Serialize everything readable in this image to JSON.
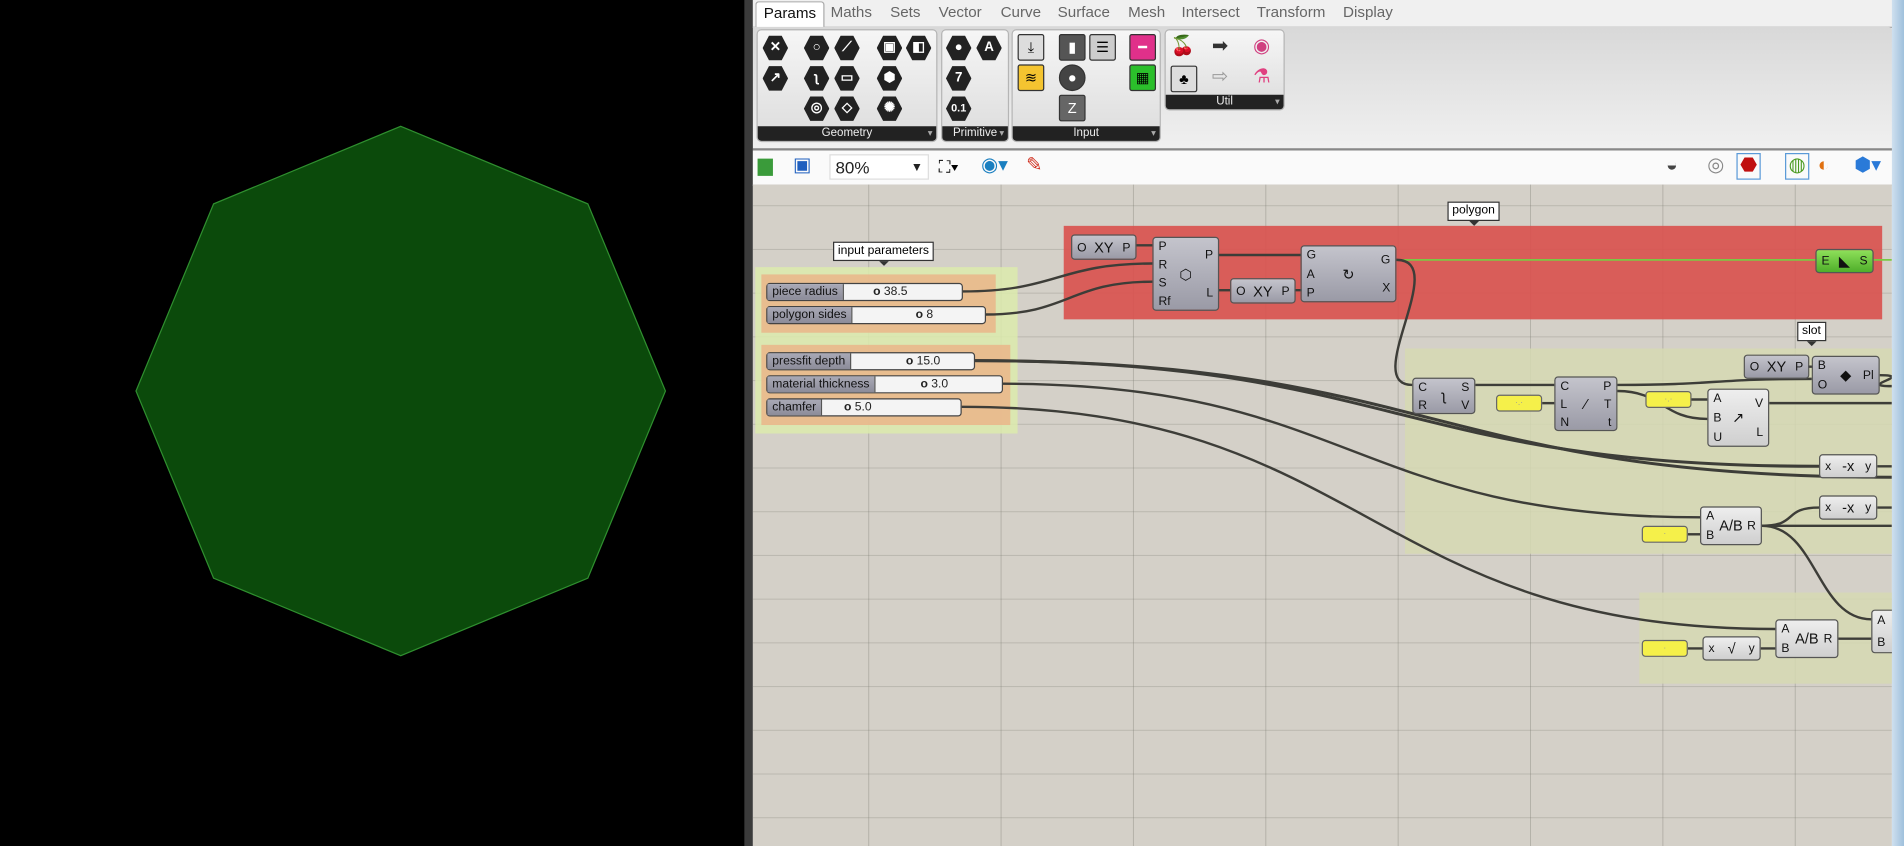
{
  "viewport": {
    "shape": "octagon",
    "fill": "#0b4a0b",
    "stroke": "#2f8f2f",
    "background": "#000000"
  },
  "tabs": [
    "Params",
    "Maths",
    "Sets",
    "Vector",
    "Curve",
    "Surface",
    "Mesh",
    "Intersect",
    "Transform",
    "Display"
  ],
  "selected_tab": "Params",
  "ribbon": {
    "panels": [
      {
        "label": "Geometry"
      },
      {
        "label": "Primitive",
        "glyphs": [
          "A",
          "7",
          "0.1"
        ]
      },
      {
        "label": "Input"
      },
      {
        "label": "Util"
      }
    ]
  },
  "toolbar": {
    "zoom": "80%",
    "icons_left": [
      "open-folder-icon",
      "save-icon",
      "zoom-extents-icon",
      "preview-eye-icon",
      "sketch-icon"
    ],
    "icons_right": [
      "preview-off-icon",
      "wireframe-preview-icon",
      "shaded-preview-icon",
      "selected-only-icon",
      "document-preview-icon",
      "display-mode-icon"
    ]
  },
  "groups": {
    "input_parameters": "input parameters",
    "polygon": "polygon",
    "slot": "slot"
  },
  "sliders": [
    {
      "label": "piece radius",
      "value": "38.5"
    },
    {
      "label": "polygon sides",
      "value": "8"
    },
    {
      "label": "pressfit depth",
      "value": "15.0"
    },
    {
      "label": "material thickness",
      "value": "3.0"
    },
    {
      "label": "chamfer",
      "value": "5.0"
    }
  ],
  "nodes": {
    "xy1": {
      "inputs": [
        "O"
      ],
      "outputs": [
        "P"
      ],
      "icon": "XY"
    },
    "polygon": {
      "inputs": [
        "P",
        "R",
        "S",
        "Rf"
      ],
      "outputs": [
        "P",
        "L"
      ],
      "icon": "⬡"
    },
    "xy2": {
      "inputs": [
        "O"
      ],
      "outputs": [
        "P"
      ],
      "icon": "XY"
    },
    "orient": {
      "inputs": [
        "G",
        "A",
        "P"
      ],
      "outputs": [
        "G",
        "X"
      ],
      "icon": "↻"
    },
    "explode": {
      "inputs": [
        "E"
      ],
      "outputs": [
        "S"
      ],
      "icon": "◣"
    },
    "segments": {
      "inputs": [
        "C",
        "R"
      ],
      "outputs": [
        "S",
        "V"
      ],
      "icon": "ʅ"
    },
    "panel1": {
      "inputs": [],
      "outputs": [],
      "icon": "·.·"
    },
    "divide": {
      "inputs": [
        "C",
        "L",
        "N"
      ],
      "outputs": [
        "P",
        "T",
        "t"
      ],
      "icon": "⁄"
    },
    "panel2": {
      "inputs": [],
      "outputs": [],
      "icon": "·.·"
    },
    "vector": {
      "inputs": [
        "A",
        "B",
        "U"
      ],
      "outputs": [
        "V",
        "L"
      ],
      "icon": "↗"
    },
    "xy3": {
      "inputs": [
        "O"
      ],
      "outputs": [
        "P"
      ],
      "icon": "XY"
    },
    "plane": {
      "inputs": [
        "B",
        "O"
      ],
      "outputs": [
        "Pl"
      ],
      "icon": "◆"
    },
    "neg1": {
      "inputs": [
        "x"
      ],
      "outputs": [
        "y"
      ],
      "icon": "-x"
    },
    "neg2": {
      "inputs": [
        "x"
      ],
      "outputs": [
        "y"
      ],
      "icon": "-x"
    },
    "div1": {
      "inputs": [
        "A",
        "B"
      ],
      "outputs": [
        "R"
      ],
      "icon": "A/B"
    },
    "panel3": {
      "inputs": [],
      "outputs": [],
      "icon": "·"
    },
    "panel4": {
      "inputs": [],
      "outputs": [],
      "icon": "·"
    },
    "sqrt": {
      "inputs": [
        "x"
      ],
      "outputs": [
        "y"
      ],
      "icon": "√"
    },
    "div2": {
      "inputs": [
        "A",
        "B"
      ],
      "outputs": [
        "R"
      ],
      "icon": "A/B"
    },
    "partial": {
      "inputs": [
        "A",
        "B"
      ],
      "outputs": [],
      "icon": ""
    }
  },
  "colors": {
    "polygon_group": "#d9534f",
    "input_group": "#dcebad",
    "slot_group": "#d6d9b3",
    "subgroup": "#eab58a",
    "preview_wire": "#7ac943"
  }
}
